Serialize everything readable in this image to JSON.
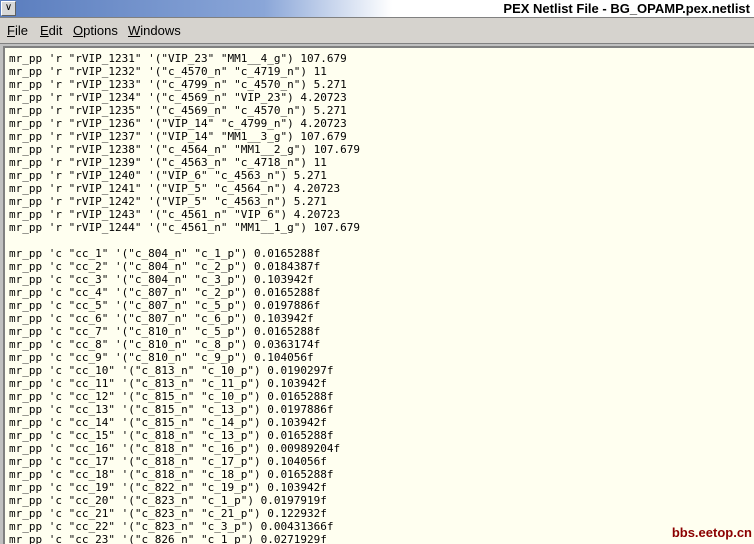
{
  "window": {
    "title": "PEX Netlist File - BG_OPAMP.pex.netlist",
    "sys_icon": "chevron-down-icon"
  },
  "menu": [
    "File",
    "Edit",
    "Options",
    "Windows"
  ],
  "lines": [
    "mr_pp 'r \"rVIP_1231\" '(\"VIP_23\" \"MM1__4_g\") 107.679",
    "mr_pp 'r \"rVIP_1232\" '(\"c_4570_n\" \"c_4719_n\") 11",
    "mr_pp 'r \"rVIP_1233\" '(\"c_4799_n\" \"c_4570_n\") 5.271",
    "mr_pp 'r \"rVIP_1234\" '(\"c_4569_n\" \"VIP_23\") 4.20723",
    "mr_pp 'r \"rVIP_1235\" '(\"c_4569_n\" \"c_4570_n\") 5.271",
    "mr_pp 'r \"rVIP_1236\" '(\"VIP_14\" \"c_4799_n\") 4.20723",
    "mr_pp 'r \"rVIP_1237\" '(\"VIP_14\" \"MM1__3_g\") 107.679",
    "mr_pp 'r \"rVIP_1238\" '(\"c_4564_n\" \"MM1__2_g\") 107.679",
    "mr_pp 'r \"rVIP_1239\" '(\"c_4563_n\" \"c_4718_n\") 11",
    "mr_pp 'r \"rVIP_1240\" '(\"VIP_6\" \"c_4563_n\") 5.271",
    "mr_pp 'r \"rVIP_1241\" '(\"VIP_5\" \"c_4564_n\") 4.20723",
    "mr_pp 'r \"rVIP_1242\" '(\"VIP_5\" \"c_4563_n\") 5.271",
    "mr_pp 'r \"rVIP_1243\" '(\"c_4561_n\" \"VIP_6\") 4.20723",
    "mr_pp 'r \"rVIP_1244\" '(\"c_4561_n\" \"MM1__1_g\") 107.679",
    "",
    "mr_pp 'c \"cc_1\" '(\"c_804_n\" \"c_1_p\") 0.0165288f",
    "mr_pp 'c \"cc_2\" '(\"c_804_n\" \"c_2_p\") 0.0184387f",
    "mr_pp 'c \"cc_3\" '(\"c_804_n\" \"c_3_p\") 0.103942f",
    "mr_pp 'c \"cc_4\" '(\"c_807_n\" \"c_2_p\") 0.0165288f",
    "mr_pp 'c \"cc_5\" '(\"c_807_n\" \"c_5_p\") 0.0197886f",
    "mr_pp 'c \"cc_6\" '(\"c_807_n\" \"c_6_p\") 0.103942f",
    "mr_pp 'c \"cc_7\" '(\"c_810_n\" \"c_5_p\") 0.0165288f",
    "mr_pp 'c \"cc_8\" '(\"c_810_n\" \"c_8_p\") 0.0363174f",
    "mr_pp 'c \"cc_9\" '(\"c_810_n\" \"c_9_p\") 0.104056f",
    "mr_pp 'c \"cc_10\" '(\"c_813_n\" \"c_10_p\") 0.0190297f",
    "mr_pp 'c \"cc_11\" '(\"c_813_n\" \"c_11_p\") 0.103942f",
    "mr_pp 'c \"cc_12\" '(\"c_815_n\" \"c_10_p\") 0.0165288f",
    "mr_pp 'c \"cc_13\" '(\"c_815_n\" \"c_13_p\") 0.0197886f",
    "mr_pp 'c \"cc_14\" '(\"c_815_n\" \"c_14_p\") 0.103942f",
    "mr_pp 'c \"cc_15\" '(\"c_818_n\" \"c_13_p\") 0.0165288f",
    "mr_pp 'c \"cc_16\" '(\"c_818_n\" \"c_16_p\") 0.00989204f",
    "mr_pp 'c \"cc_17\" '(\"c_818_n\" \"c_17_p\") 0.104056f",
    "mr_pp 'c \"cc_18\" '(\"c_818_n\" \"c_18_p\") 0.0165288f",
    "mr_pp 'c \"cc_19\" '(\"c_822_n\" \"c_19_p\") 0.103942f",
    "mr_pp 'c \"cc_20\" '(\"c_823_n\" \"c_1_p\") 0.0197919f",
    "mr_pp 'c \"cc_21\" '(\"c_823_n\" \"c_21_p\") 0.122932f",
    "mr_pp 'c \"cc_22\" '(\"c_823_n\" \"c_3_p\") 0.00431366f",
    "mr_pp 'c \"cc_23\" '(\"c_826_n\" \"c_1_p\") 0.0271929f"
  ],
  "watermark": "bbs.eetop.cn"
}
